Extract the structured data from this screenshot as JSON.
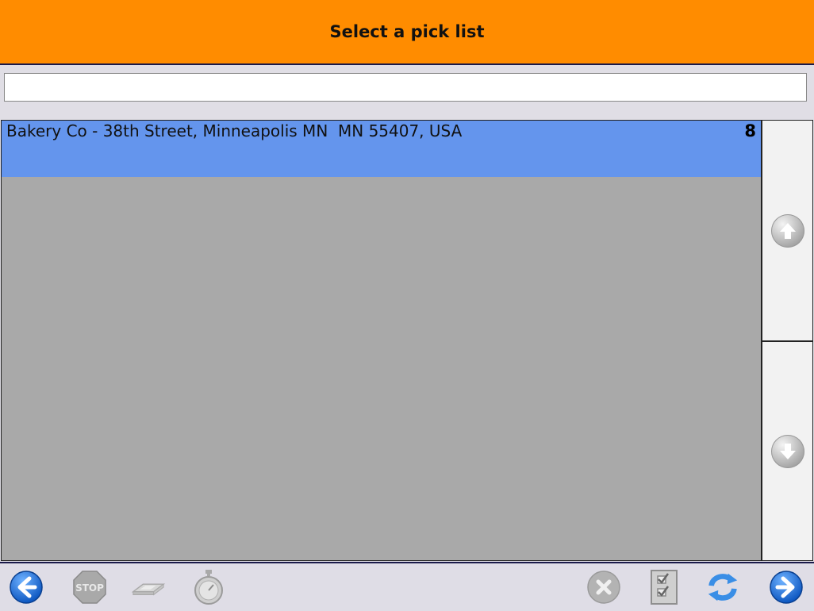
{
  "header": {
    "title": "Select a pick list"
  },
  "search": {
    "value": ""
  },
  "pick_lists": [
    {
      "label": "Bakery Co - 38th Street, Minneapolis MN  MN 55407, USA",
      "count": "8",
      "selected": true
    }
  ],
  "colors": {
    "header": "#ff8c00",
    "selected_row": "#6495ed",
    "list_background": "#a9a9a9",
    "toolbar_background": "#dfdde6",
    "nav_blue": "#1f6fd1"
  },
  "icons": {
    "back": "back-arrow-icon",
    "stop": "stop-sign-icon",
    "scanner": "scanner-icon",
    "timer": "stopwatch-icon",
    "cancel": "cancel-x-icon",
    "checklist": "checklist-icon",
    "refresh": "refresh-icon",
    "forward": "forward-arrow-icon",
    "scroll_up": "arrow-up-icon",
    "scroll_down": "arrow-down-icon"
  },
  "toolbar": {
    "stop_label": "STOP"
  }
}
